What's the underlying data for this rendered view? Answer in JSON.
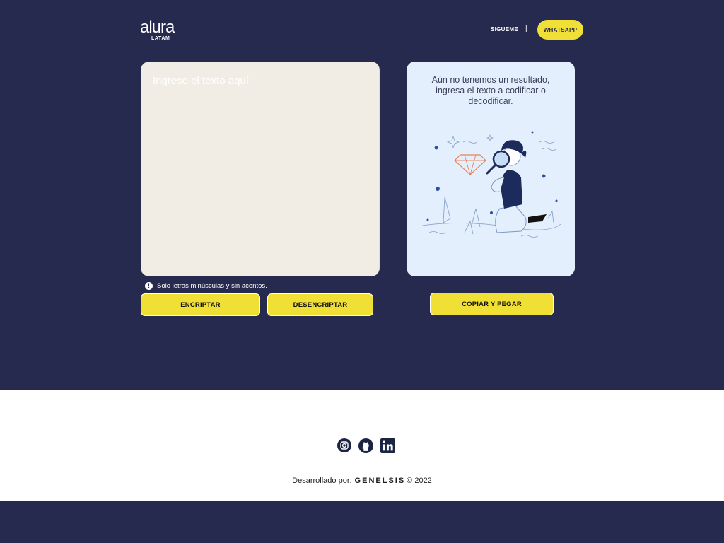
{
  "header": {
    "logo_main": "alura",
    "logo_sub": "LATAM",
    "follow_label": "SIGUEME",
    "separator": "|",
    "whatsapp_label": "WHATSAPP"
  },
  "input": {
    "placeholder": "Ingrese el texto aquí",
    "value": ""
  },
  "hint": {
    "icon": "!",
    "text": "Solo letras minúsculas y sin acentos."
  },
  "actions": {
    "encrypt_label": "ENCRIPTAR",
    "decrypt_label": "DESENCRIPTAR",
    "copy_label": "COPIAR Y PEGAR"
  },
  "result": {
    "empty_message": "Aún no tenemos un resultado, ingresa el texto a codificar o decodificar."
  },
  "footer": {
    "developed_by": "Desarrollado por:",
    "brand": "GENELSIS",
    "copyright": "© 2022",
    "social": [
      "instagram-icon",
      "github-icon",
      "linkedin-icon"
    ]
  },
  "colors": {
    "background": "#262a4e",
    "accent": "#f0e035",
    "input_bg": "#f2ede4",
    "result_bg": "#e4effd",
    "footer_bg": "#ffffff"
  }
}
